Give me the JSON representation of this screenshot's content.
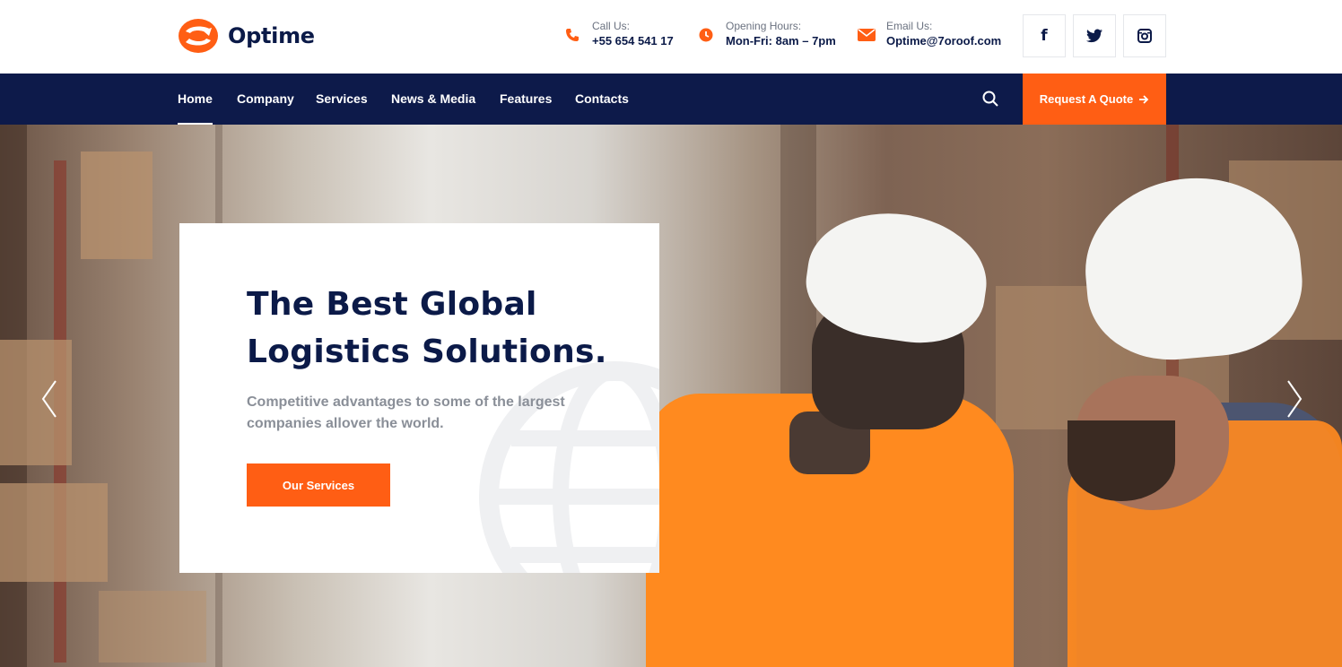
{
  "brand": {
    "name": "Optime",
    "accent": "#ff5e14",
    "navy": "#0d1a4a"
  },
  "contacts": [
    {
      "icon": "phone-icon",
      "label": "Call Us:",
      "value": "+55 654 541 17"
    },
    {
      "icon": "clock-icon",
      "label": "Opening Hours:",
      "value": "Mon-Fri: 8am – 7pm"
    },
    {
      "icon": "envelope-icon",
      "label": "Email Us:",
      "value": "Optime@7oroof.com"
    }
  ],
  "social": [
    {
      "icon": "facebook-icon",
      "glyph": "f"
    },
    {
      "icon": "twitter-icon"
    },
    {
      "icon": "instagram-icon"
    }
  ],
  "nav": {
    "items": [
      "Home",
      "Company",
      "Services",
      "News & Media",
      "Features",
      "Contacts"
    ],
    "active": "Home",
    "quote_label": "Request A Quote"
  },
  "hero": {
    "title_line1": "The Best Global",
    "title_line2": "Logistics Solutions.",
    "subtitle_line1": "Competitive advantages to some of the largest",
    "subtitle_line2": "companies allover the world.",
    "button_label": "Our Services"
  }
}
